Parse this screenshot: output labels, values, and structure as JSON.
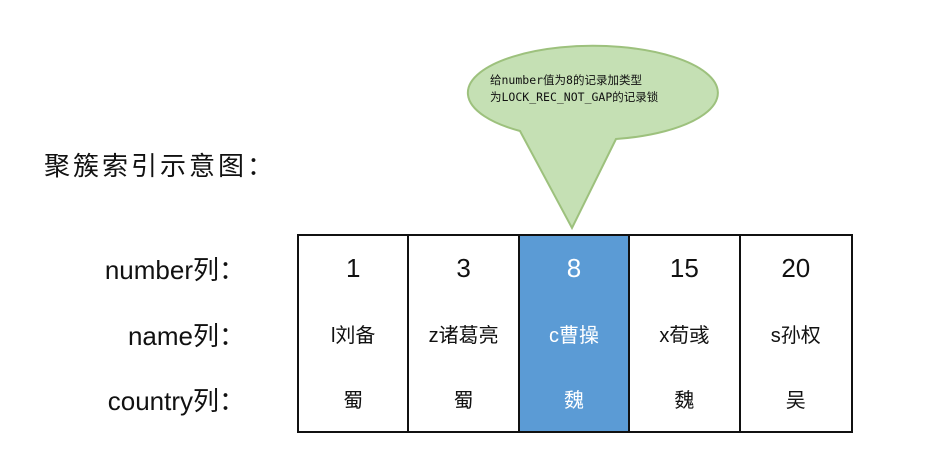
{
  "title": "聚簇索引示意图：",
  "row_labels": {
    "number": "number列：",
    "name": "name列：",
    "country": "country列："
  },
  "columns": [
    {
      "number": "1",
      "name": "l刘备",
      "country": "蜀",
      "highlighted": false
    },
    {
      "number": "3",
      "name": "z诸葛亮",
      "country": "蜀",
      "highlighted": false
    },
    {
      "number": "8",
      "name": "c曹操",
      "country": "魏",
      "highlighted": true
    },
    {
      "number": "15",
      "name": "x荀彧",
      "country": "魏",
      "highlighted": false
    },
    {
      "number": "20",
      "name": "s孙权",
      "country": "吴",
      "highlighted": false
    }
  ],
  "callout": {
    "line1": "给number值为8的记录加类型",
    "line2": "为LOCK_REC_NOT_GAP的记录锁"
  },
  "colors": {
    "highlight": "#5b9bd5",
    "callout_fill": "#c5e0b4",
    "callout_stroke": "#9dc17d"
  }
}
